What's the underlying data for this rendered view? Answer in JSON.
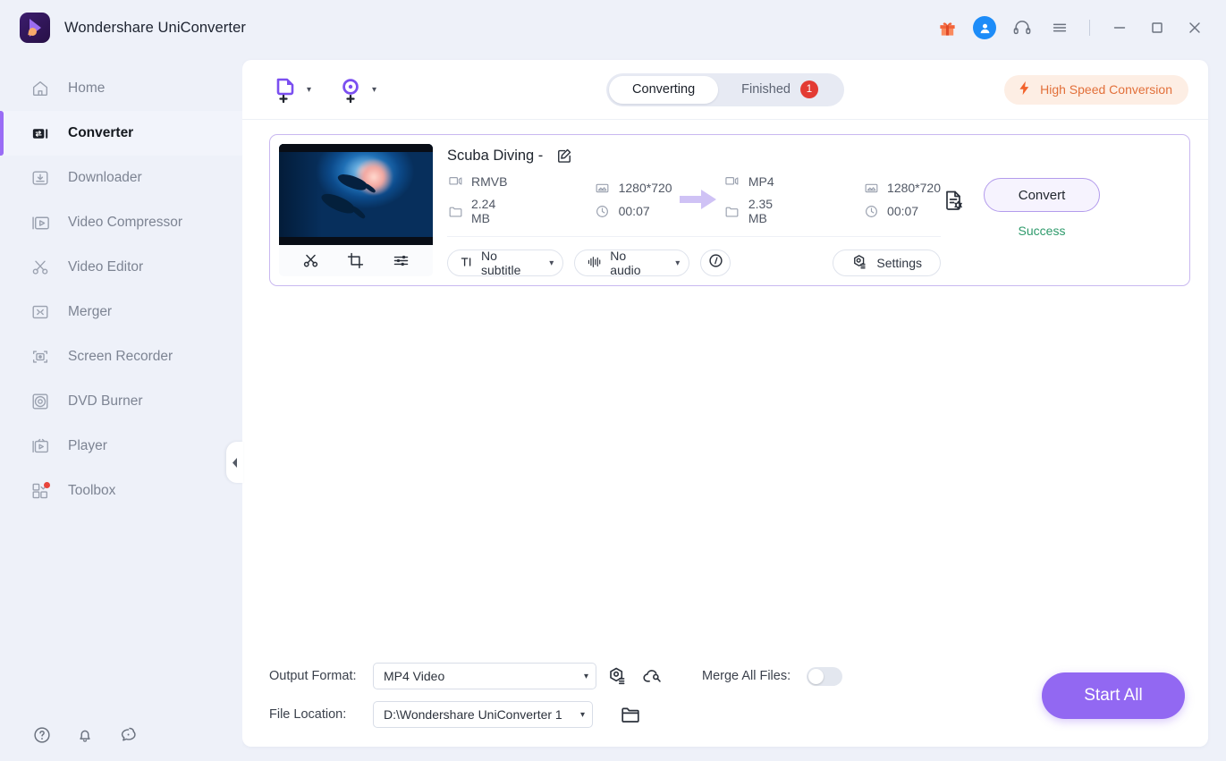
{
  "window": {
    "app_title": "Wondershare UniConverter",
    "controls": {
      "gift": "gift-icon",
      "account": "account-icon",
      "support": "headset-icon",
      "menu": "hamburger-menu-icon",
      "minimize": "minimize-icon",
      "maximize": "maximize-icon",
      "close": "close-icon"
    }
  },
  "sidebar": {
    "items": [
      {
        "label": "Home",
        "icon": "home-icon",
        "active": false,
        "badge": false
      },
      {
        "label": "Converter",
        "icon": "converter-icon",
        "active": true,
        "badge": false
      },
      {
        "label": "Downloader",
        "icon": "download-icon",
        "active": false,
        "badge": false
      },
      {
        "label": "Video Compressor",
        "icon": "compressor-icon",
        "active": false,
        "badge": false
      },
      {
        "label": "Video Editor",
        "icon": "scissors-icon",
        "active": false,
        "badge": false
      },
      {
        "label": "Merger",
        "icon": "merger-icon",
        "active": false,
        "badge": false
      },
      {
        "label": "Screen Recorder",
        "icon": "screen-recorder-icon",
        "active": false,
        "badge": false
      },
      {
        "label": "DVD Burner",
        "icon": "disc-icon",
        "active": false,
        "badge": false
      },
      {
        "label": "Player",
        "icon": "player-icon",
        "active": false,
        "badge": false
      },
      {
        "label": "Toolbox",
        "icon": "toolbox-icon",
        "active": false,
        "badge": true
      }
    ],
    "footer": [
      {
        "name": "help-icon"
      },
      {
        "name": "bell-icon"
      },
      {
        "name": "feedback-icon"
      }
    ],
    "collapse": "collapse-sidebar-arrow"
  },
  "toolbar": {
    "add_files_icon": "add-file-icon",
    "add_dvd_icon": "add-dvd-icon",
    "tabs": [
      {
        "label": "Converting",
        "active": true,
        "count": ""
      },
      {
        "label": "Finished",
        "active": false,
        "count": "1"
      }
    ],
    "high_speed": {
      "label": "High Speed Conversion",
      "icon": "lightning-icon"
    }
  },
  "file_card": {
    "title": "Scuba Diving -",
    "edit_icon": "edit-pencil-icon",
    "thumbnail_alt": "scuba-diving-underwater-thumbnail",
    "thumb_tools": [
      {
        "name": "trim-scissors-icon"
      },
      {
        "name": "crop-icon"
      },
      {
        "name": "effect-sliders-icon"
      }
    ],
    "source": {
      "format": "RMVB",
      "resolution": "1280*720",
      "size": "2.24 MB",
      "duration": "00:07"
    },
    "target": {
      "format": "MP4",
      "resolution": "1280*720",
      "size": "2.35 MB",
      "duration": "00:07"
    },
    "arrow_icon": "convert-arrow-icon",
    "subtitle_select": {
      "value": "No subtitle",
      "icon": "subtitle-icon"
    },
    "audio_select": {
      "value": "No audio",
      "icon": "audio-wave-icon"
    },
    "info_button": "info-icon",
    "settings_button": {
      "label": "Settings",
      "icon": "settings-gear-icon"
    },
    "doc_settings_icon": "file-settings-icon",
    "convert_button": "Convert",
    "status": "Success",
    "status_color": "#2e9a6b"
  },
  "bottom_bar": {
    "output_format_label": "Output Format:",
    "output_format_value": "MP4 Video",
    "output_format_icons": [
      {
        "name": "format-settings-icon"
      },
      {
        "name": "cloud-convert-icon"
      }
    ],
    "file_location_label": "File Location:",
    "file_location_value": "D:\\Wondershare UniConverter 1",
    "folder_icon": "open-folder-icon",
    "merge_label": "Merge All Files:",
    "merge_enabled": false,
    "start_all_button": "Start All"
  },
  "colors": {
    "accent": "#9268f2",
    "card_border": "#c9b8f0",
    "success": "#2e9a6b",
    "badge_red": "#e33b33",
    "high_speed": "#e2703a",
    "sidebar_bg": "#eef1f9"
  }
}
